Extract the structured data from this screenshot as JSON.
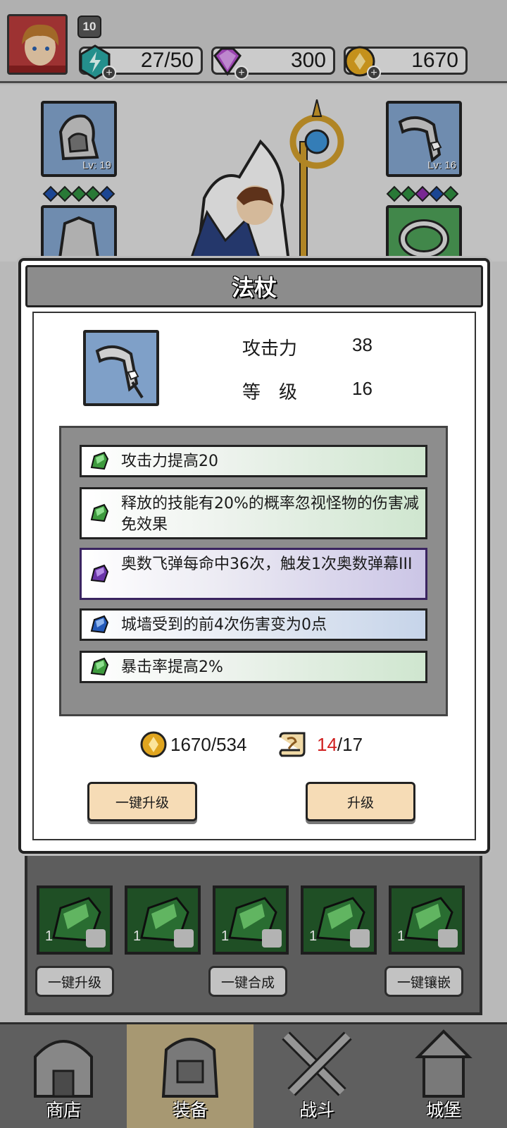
{
  "header": {
    "player_level": "10",
    "energy": "27/50",
    "gems": "300",
    "gold": "1670"
  },
  "hero": {
    "slots": [
      {
        "name": "helmet",
        "level": "Lv: 19"
      },
      {
        "name": "weapon",
        "level": "Lv: 16"
      }
    ],
    "left_gems": [
      "#1e4fa8",
      "#2e8a3e",
      "#2e8a3e",
      "#2e8a3e",
      "#1e4fa8"
    ],
    "right_gems": [
      "#2e8a3e",
      "#2e8a3e",
      "#8a2ea8",
      "#1e4fa8",
      "#2e8a3e"
    ]
  },
  "modal": {
    "title": "法杖",
    "stats": {
      "attack_label": "攻击力",
      "attack_value": "38",
      "level_label": "等　级",
      "level_value": "16"
    },
    "affixes": [
      {
        "text": "攻击力提高20",
        "rarity": "green"
      },
      {
        "text": "释放的技能有20%的概率忽视怪物的伤害减免效果",
        "rarity": "green"
      },
      {
        "text": "奥数飞弹每命中36次，触发1次奥数弹幕III",
        "rarity": "purple"
      },
      {
        "text": "城墙受到的前4次伤害变为0点",
        "rarity": "blue"
      },
      {
        "text": "暴击率提高2%",
        "rarity": "green"
      }
    ],
    "cost": {
      "gold": "1670/534",
      "scroll_have": "14",
      "scroll_sep_need": "/17"
    },
    "buttons": {
      "upgrade_all": "一键升级",
      "upgrade": "升级"
    }
  },
  "inventory": {
    "count": "1",
    "buttons": {
      "upgrade_all": "一键升级",
      "merge_all": "一键合成",
      "inlay_all": "一键镶嵌"
    }
  },
  "nav": {
    "tabs": [
      {
        "label": "商店"
      },
      {
        "label": "装备"
      },
      {
        "label": "战斗"
      },
      {
        "label": "城堡"
      }
    ],
    "active": "装备"
  }
}
